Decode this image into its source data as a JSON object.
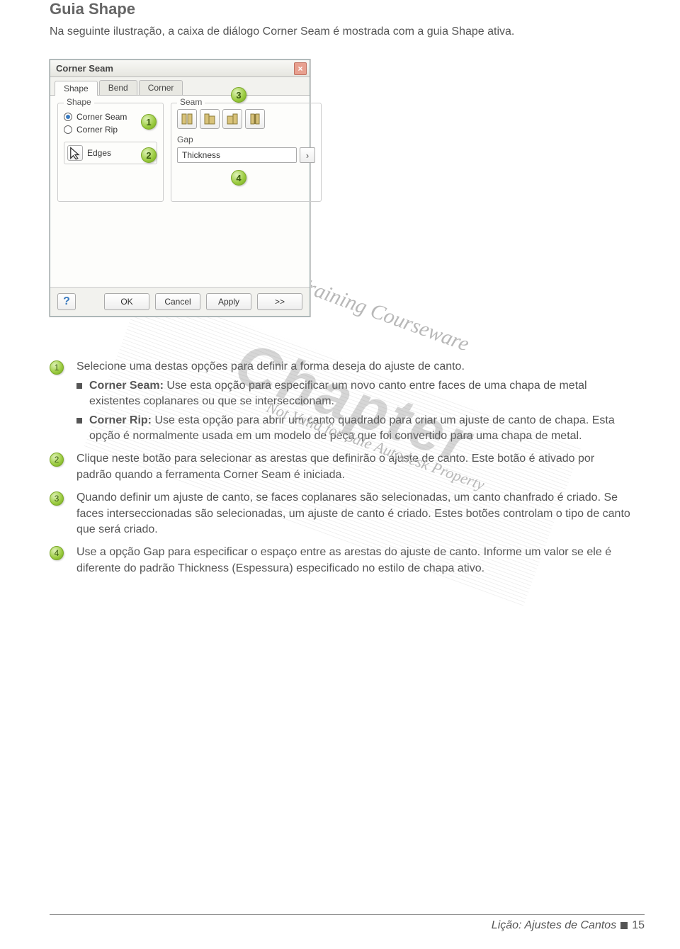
{
  "heading": "Guia Shape",
  "intro": "Na seguinte ilustração, a caixa de diálogo Corner Seam é mostrada com a guia Shape ativa.",
  "dialog": {
    "title": "Corner Seam",
    "tabs": [
      "Shape",
      "Bend",
      "Corner"
    ],
    "shape_group": {
      "title": "Shape",
      "radio_corner_seam": "Corner Seam",
      "radio_corner_rip": "Corner Rip",
      "edges_label": "Edges"
    },
    "seam_group": {
      "title": "Seam",
      "gap_label": "Gap",
      "gap_value": "Thickness"
    },
    "buttons": {
      "ok": "OK",
      "cancel": "Cancel",
      "apply": "Apply",
      "expand": ">>",
      "help": "?"
    }
  },
  "callouts": {
    "c1": "1",
    "c2": "2",
    "c3": "3",
    "c4": "4"
  },
  "watermarks": {
    "line1": "Autodesk Authorized Training Courseware",
    "line2": "Chapter",
    "line3": "Not Valid for Sale    Autodesk Property"
  },
  "explain": {
    "item1_lead": "Selecione uma destas opções para definir a forma deseja do ajuste de canto.",
    "item1_b1_bold": "Corner Seam:",
    "item1_b1_rest": " Use esta opção para especificar um novo canto entre faces de uma chapa de metal existentes coplanares ou que se interseccionam.",
    "item1_b2_bold": "Corner Rip:",
    "item1_b2_rest": " Use esta opção para abrir um canto quadrado para criar um ajuste de canto de chapa. Esta opção é normalmente usada em um modelo de peça que foi convertido para uma chapa de metal.",
    "item2": "Clique neste botão para selecionar as arestas que definirão o ajuste de canto. Este botão é ativado por padrão quando a ferramenta Corner Seam é iniciada.",
    "item3": "Quando definir um ajuste de canto, se faces coplanares são selecionadas, um canto chanfrado é criado. Se faces interseccionadas são selecionadas, um ajuste de canto é criado. Estes botões controlam o tipo de canto que será criado.",
    "item4": "Use a opção Gap para especificar o espaço entre as arestas do ajuste de canto. Informe um valor se ele é diferente do padrão Thickness (Espessura) especificado no estilo de chapa ativo."
  },
  "footer": {
    "text": "Lição: Ajustes de Cantos",
    "page": "15"
  }
}
